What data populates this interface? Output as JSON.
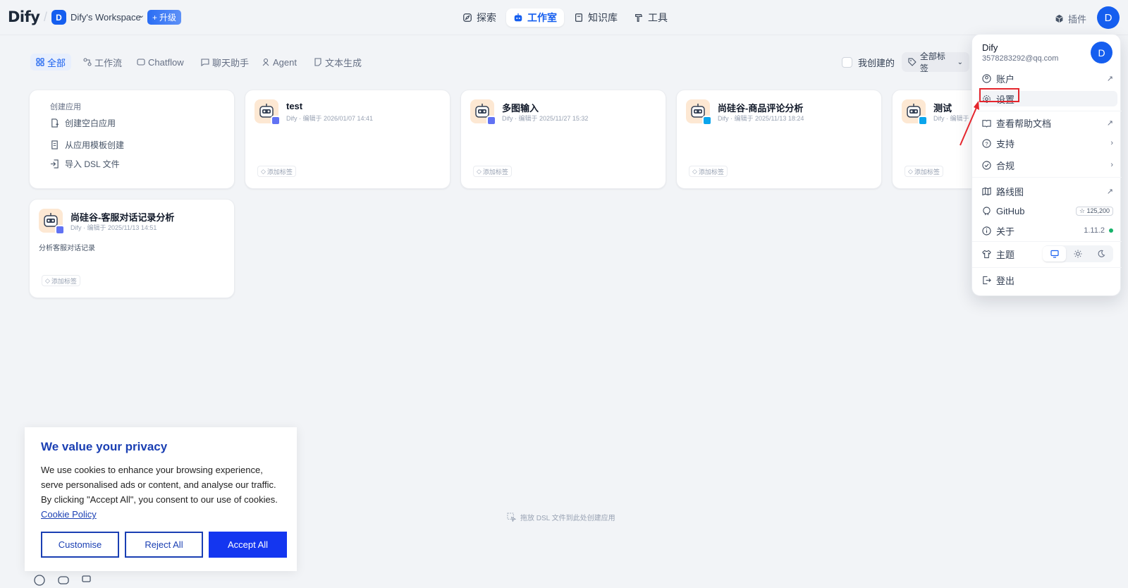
{
  "nav": {
    "logo": "Dify",
    "workspace_initial": "D",
    "workspace_name": "Dify's Workspace",
    "upgrade_label": "升级",
    "tabs": [
      {
        "label": "探索",
        "icon": "compass-icon"
      },
      {
        "label": "工作室",
        "icon": "robot-icon"
      },
      {
        "label": "知识库",
        "icon": "book-icon"
      },
      {
        "label": "工具",
        "icon": "hammer-icon"
      }
    ],
    "active_tab": "工作室",
    "plugin_label": "插件",
    "user_initial": "D"
  },
  "filters": {
    "tabs": [
      "全部",
      "工作流",
      "Chatflow",
      "聊天助手",
      "Agent",
      "文本生成"
    ],
    "active": "全部",
    "my_created_label": "我创建的",
    "tag_filter_label": "全部标签"
  },
  "create_card": {
    "title": "创建应用",
    "items": [
      "创建空白应用",
      "从应用模板创建",
      "导入 DSL 文件"
    ]
  },
  "apps": [
    {
      "name": "test",
      "meta": "Dify · 编辑于 2026/01/07 14:41",
      "desc": "",
      "tag_label": "添加标签",
      "badge_color": "#6172f3"
    },
    {
      "name": "多图输入",
      "meta": "Dify · 编辑于 2025/11/27 15:32",
      "desc": "",
      "tag_label": "添加标签",
      "badge_color": "#6172f3"
    },
    {
      "name": "尚硅谷-商品评论分析",
      "meta": "Dify · 编辑于 2025/11/13 18:24",
      "desc": "",
      "tag_label": "添加标签",
      "badge_color": "#0ba5ec"
    },
    {
      "name": "测试",
      "meta": "Dify · 编辑于",
      "desc": "",
      "tag_label": "添加标签",
      "badge_color": "#0ba5ec"
    },
    {
      "name": "尚硅谷-客服对话记录分析",
      "meta": "Dify · 编辑于 2025/11/13 14:51",
      "desc": "分析客服对话记录",
      "tag_label": "添加标签",
      "badge_color": "#6172f3"
    }
  ],
  "dropdown": {
    "name": "Dify",
    "email": "3578283292@qq.com",
    "avatar_initial": "D",
    "items": {
      "account": "账户",
      "settings": "设置",
      "help_docs": "查看帮助文档",
      "support": "支持",
      "compliance": "合规",
      "roadmap": "路线图",
      "github": "GitHub",
      "github_stars": "125,200",
      "about": "关于",
      "version": "1.11.2",
      "theme": "主题",
      "logout": "登出"
    }
  },
  "drop_hint": "拖放 DSL 文件到此处创建应用",
  "cookie": {
    "title": "We value your privacy",
    "text": "We use cookies to enhance your browsing experience, serve personalised ads or content, and analyse our traffic. By clicking \"Accept All\", you consent to our use of cookies.",
    "policy_link": "Cookie Policy",
    "customise": "Customise",
    "reject": "Reject All",
    "accept": "Accept All"
  },
  "colors": {
    "accent": "#155eef",
    "highlight_box": "#e5262d",
    "cookie_primary": "#1436f0"
  }
}
